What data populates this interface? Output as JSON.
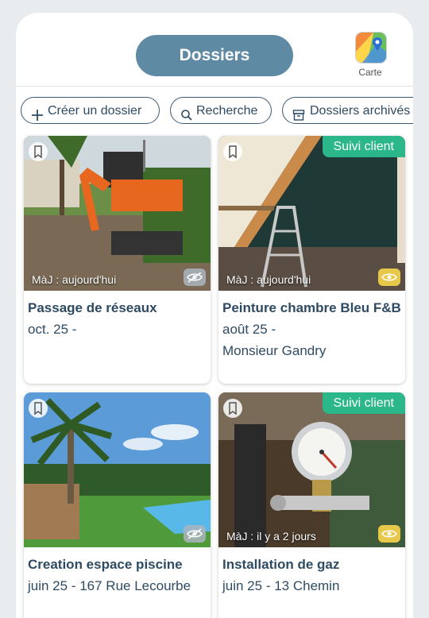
{
  "header": {
    "title": "Dossiers",
    "map_label": "Carte"
  },
  "filters": [
    {
      "label": "Créer un dossier",
      "icon": "plus-icon"
    },
    {
      "label": "Recherche",
      "icon": "search-icon"
    },
    {
      "label": "Dossiers archivés",
      "icon": "archive-icon"
    }
  ],
  "cards": [
    {
      "title": "Passage de réseaux",
      "line1": "oct. 25 -",
      "line2": "",
      "updated": "MàJ : aujourd'hui",
      "badge": "",
      "visibility": "hidden"
    },
    {
      "title": "Peinture chambre Bleu F&B",
      "line1": "août 25 -",
      "line2": "Monsieur Gandry",
      "updated": "MàJ : aujourd'hui",
      "badge": "Suivi client",
      "visibility": "visible"
    },
    {
      "title": "Creation espace piscine",
      "line1": "juin 25 - 167 Rue Lecourbe",
      "line2": "",
      "updated": "",
      "badge": "",
      "visibility": "hidden"
    },
    {
      "title": "Installation de gaz",
      "line1": "juin 25 - 13 Chemin",
      "line2": "",
      "updated": "MàJ : il y a 2 jours",
      "badge": "Suivi client",
      "visibility": "visible"
    }
  ],
  "colors": {
    "title_pill": "#5f8aa4",
    "badge": "#2bb789",
    "text": "#2e4b63",
    "eye_on": "#e8c84a"
  }
}
